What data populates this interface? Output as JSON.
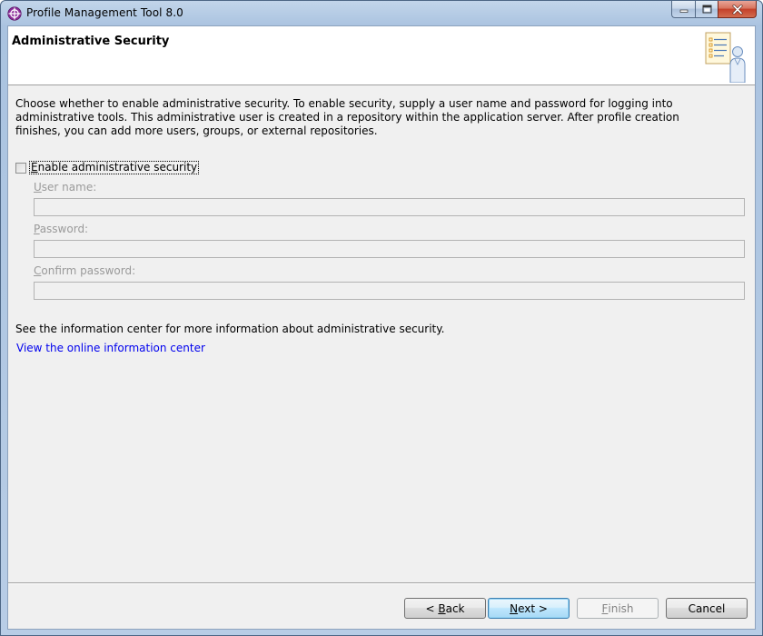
{
  "window": {
    "title": "Profile Management Tool 8.0"
  },
  "header": {
    "title": "Administrative Security"
  },
  "main": {
    "description": "Choose whether to enable administrative security. To enable security, supply a user name and password for logging into administrative tools. This administrative user is created in a repository within the application server. After profile creation finishes, you can add more users, groups, or external repositories.",
    "checkbox": {
      "mnemonic": "E",
      "label_rest": "nable administrative security",
      "checked": false
    },
    "fields": {
      "username": {
        "mnemonic": "U",
        "label_rest": "ser name:",
        "value": ""
      },
      "password": {
        "mnemonic": "P",
        "label_rest": "assword:",
        "value": ""
      },
      "confirm": {
        "mnemonic": "C",
        "label_rest": "onfirm password:",
        "value": ""
      }
    },
    "info_text": "See the information center for more information about administrative security.",
    "info_link": "View the online information center"
  },
  "buttons": {
    "back_prefix": "< ",
    "back_mnemonic": "B",
    "back_rest": "ack",
    "next_mnemonic": "N",
    "next_rest": "ext >",
    "finish_mnemonic": "F",
    "finish_rest": "inish",
    "cancel": "Cancel"
  },
  "colors": {
    "link": "#0000ee",
    "disabled_text": "#9a9a9a",
    "close_button": "#c4402a"
  },
  "icons": {
    "app": "websphere-globe-icon",
    "header": "wizard-person-checklist-icon"
  }
}
